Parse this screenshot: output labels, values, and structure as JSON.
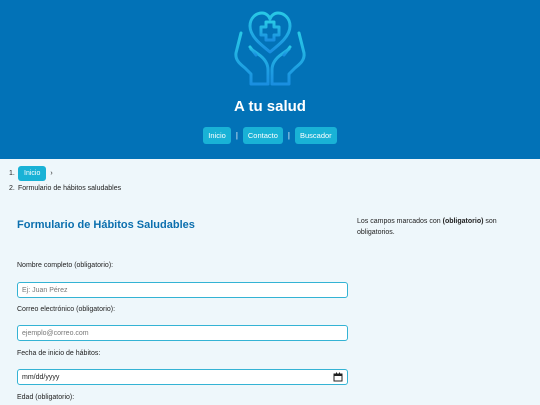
{
  "header": {
    "site_title": "A tu salud",
    "logo_icon": "hands-heart-cross-icon",
    "nav": [
      {
        "label": "Inicio"
      },
      {
        "label": "Contacto"
      },
      {
        "label": "Buscador"
      }
    ],
    "nav_separator": "|"
  },
  "breadcrumb": {
    "items": [
      {
        "number": "1.",
        "label": "Inicio",
        "arrow": "›"
      },
      {
        "number": "2.",
        "label": "Formulario de hábitos saludables"
      }
    ]
  },
  "form": {
    "title": "Formulario de Hábitos Saludables",
    "required_note_prefix": "Los campos marcados con ",
    "required_note_bold": "(obligatorio)",
    "required_note_suffix": " son obligatorios.",
    "fields": {
      "name": {
        "label": "Nombre completo (obligatorio):",
        "placeholder": "Ej: Juan Pérez"
      },
      "email": {
        "label": "Correo electrónico (obligatorio):",
        "placeholder": "ejemplo@correo.com"
      },
      "start_date": {
        "label": "Fecha de inicio de hábitos:",
        "value": "mm/dd/yyyy",
        "icon": "calendar-icon"
      },
      "age": {
        "label": "Edad (obligatorio):"
      }
    }
  },
  "colors": {
    "header_bg": "#0272b7",
    "accent": "#19b2d6",
    "title_blue": "#0b6fae",
    "page_bg": "#eef7fb"
  }
}
